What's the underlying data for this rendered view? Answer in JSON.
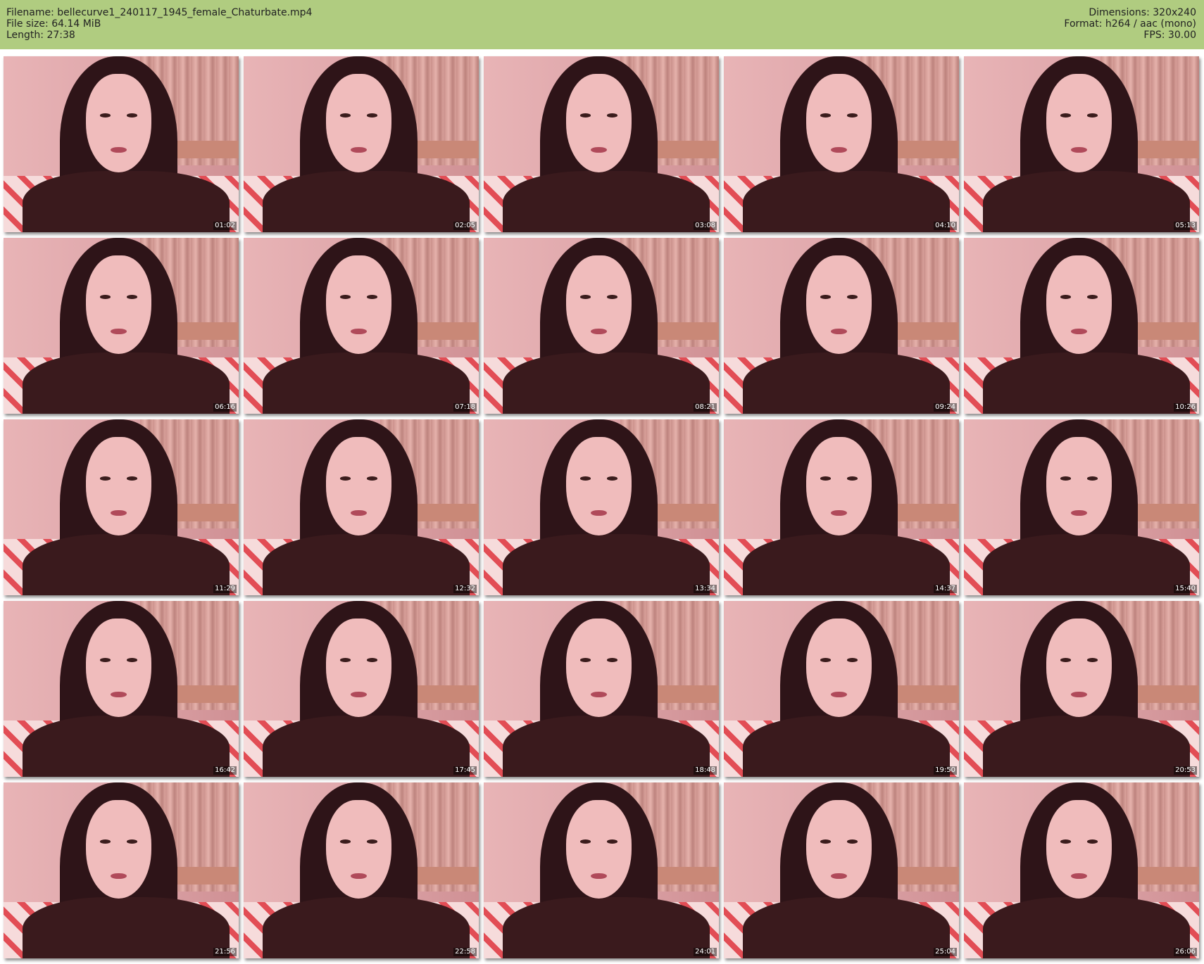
{
  "header": {
    "filename": "Filename: bellecurve1_240117_1945_female_Chaturbate.mp4",
    "filesize": "File size: 64.14 MiB",
    "length": "Length: 27:38",
    "dimensions": "Dimensions: 320x240",
    "format": "Format: h264 / aac (mono)",
    "fps": "FPS: 30.00"
  },
  "colors": {
    "header_background": "#b0cc80",
    "page_background": "#ffffff"
  },
  "thumbnails": [
    {
      "timestamp": "01:02"
    },
    {
      "timestamp": "02:05"
    },
    {
      "timestamp": "03:08"
    },
    {
      "timestamp": "04:10"
    },
    {
      "timestamp": "05:13"
    },
    {
      "timestamp": "06:16"
    },
    {
      "timestamp": "07:18"
    },
    {
      "timestamp": "08:21"
    },
    {
      "timestamp": "09:24"
    },
    {
      "timestamp": "10:26"
    },
    {
      "timestamp": "11:29"
    },
    {
      "timestamp": "12:32"
    },
    {
      "timestamp": "13:34"
    },
    {
      "timestamp": "14:37"
    },
    {
      "timestamp": "15:40"
    },
    {
      "timestamp": "16:42"
    },
    {
      "timestamp": "17:45"
    },
    {
      "timestamp": "18:48"
    },
    {
      "timestamp": "19:50"
    },
    {
      "timestamp": "20:53"
    },
    {
      "timestamp": "21:56"
    },
    {
      "timestamp": "22:58"
    },
    {
      "timestamp": "24:01"
    },
    {
      "timestamp": "25:04"
    },
    {
      "timestamp": "26:06"
    }
  ]
}
